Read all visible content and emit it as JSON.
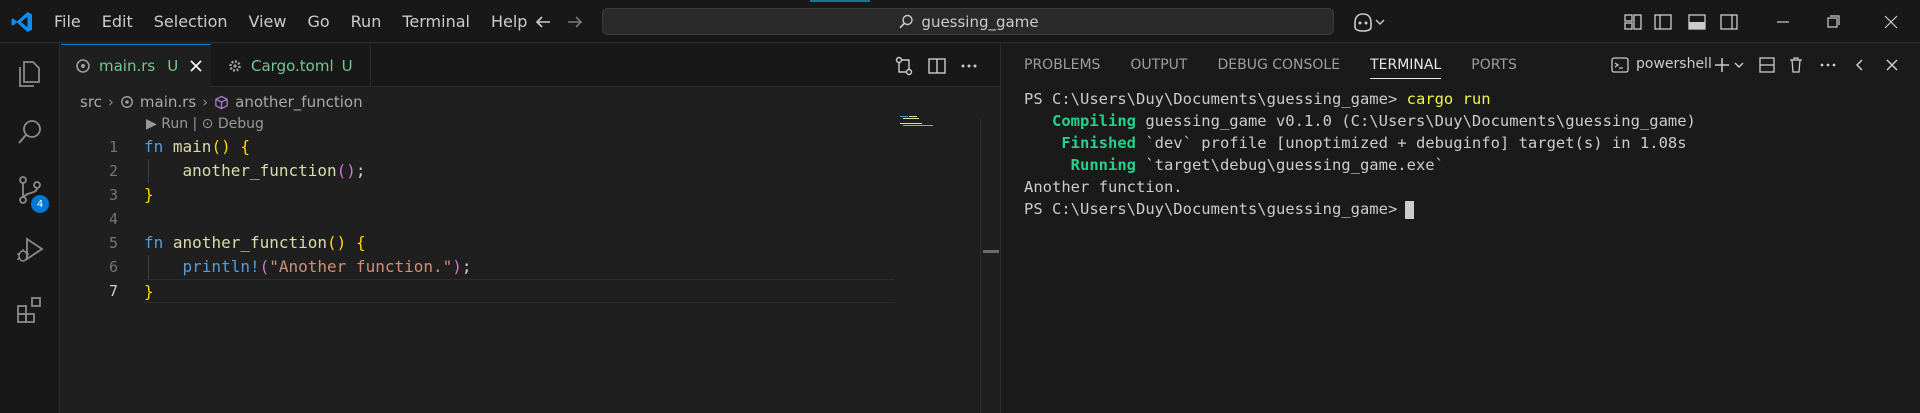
{
  "menu": [
    "File",
    "Edit",
    "Selection",
    "View",
    "Go",
    "Run",
    "Terminal",
    "Help"
  ],
  "search": {
    "text": "guessing_game"
  },
  "activity": {
    "scm_badge": "4"
  },
  "tabs": [
    {
      "name": "main.rs",
      "status": "U"
    },
    {
      "name": "Cargo.toml",
      "status": "U"
    }
  ],
  "breadcrumb": {
    "folder": "src",
    "file": "main.rs",
    "symbol": "another_function"
  },
  "codelens": "▶ Run | ⊙ Debug",
  "code": {
    "line_numbers": [
      "1",
      "2",
      "3",
      "4",
      "5",
      "6",
      "7"
    ],
    "lines": [
      [
        {
          "t": "fn",
          "c": "kw"
        },
        {
          "t": " ",
          "c": ""
        },
        {
          "t": "main",
          "c": "fnc"
        },
        {
          "t": "()",
          "c": "b1"
        },
        {
          "t": " ",
          "c": ""
        },
        {
          "t": "{",
          "c": "b1"
        }
      ],
      [
        {
          "t": "    ",
          "c": ""
        },
        {
          "t": "another_function",
          "c": "fnc"
        },
        {
          "t": "()",
          "c": "b2"
        },
        {
          "t": ";",
          "c": ""
        }
      ],
      [
        {
          "t": "}",
          "c": "b1"
        }
      ],
      [],
      [
        {
          "t": "fn",
          "c": "kw"
        },
        {
          "t": " ",
          "c": ""
        },
        {
          "t": "another_function",
          "c": "fnc"
        },
        {
          "t": "()",
          "c": "b1"
        },
        {
          "t": " ",
          "c": ""
        },
        {
          "t": "{",
          "c": "b1"
        }
      ],
      [
        {
          "t": "    ",
          "c": ""
        },
        {
          "t": "println!",
          "c": "kw"
        },
        {
          "t": "(",
          "c": "b2"
        },
        {
          "t": "\"Another function.\"",
          "c": "str"
        },
        {
          "t": ")",
          "c": "b2"
        },
        {
          "t": ";",
          "c": ""
        }
      ],
      [
        {
          "t": "}",
          "c": "b1"
        }
      ]
    ]
  },
  "panel": {
    "tabs": [
      "PROBLEMS",
      "OUTPUT",
      "DEBUG CONSOLE",
      "TERMINAL",
      "PORTS"
    ],
    "active_tab": "TERMINAL",
    "shell": "powershell"
  },
  "terminal": {
    "prompt": "PS C:\\Users\\Duy\\Documents\\guessing_game> ",
    "command": "cargo run",
    "lines": [
      {
        "label": "   Compiling",
        "text": " guessing_game v0.1.0 (C:\\Users\\Duy\\Documents\\guessing_game)"
      },
      {
        "label": "    Finished",
        "text": " `dev` profile [unoptimized + debuginfo] target(s) in 1.08s"
      },
      {
        "label": "     Running",
        "text": " `target\\debug\\guessing_game.exe`"
      }
    ],
    "output": "Another function.",
    "final_prompt": "PS C:\\Users\\Duy\\Documents\\guessing_game>"
  }
}
